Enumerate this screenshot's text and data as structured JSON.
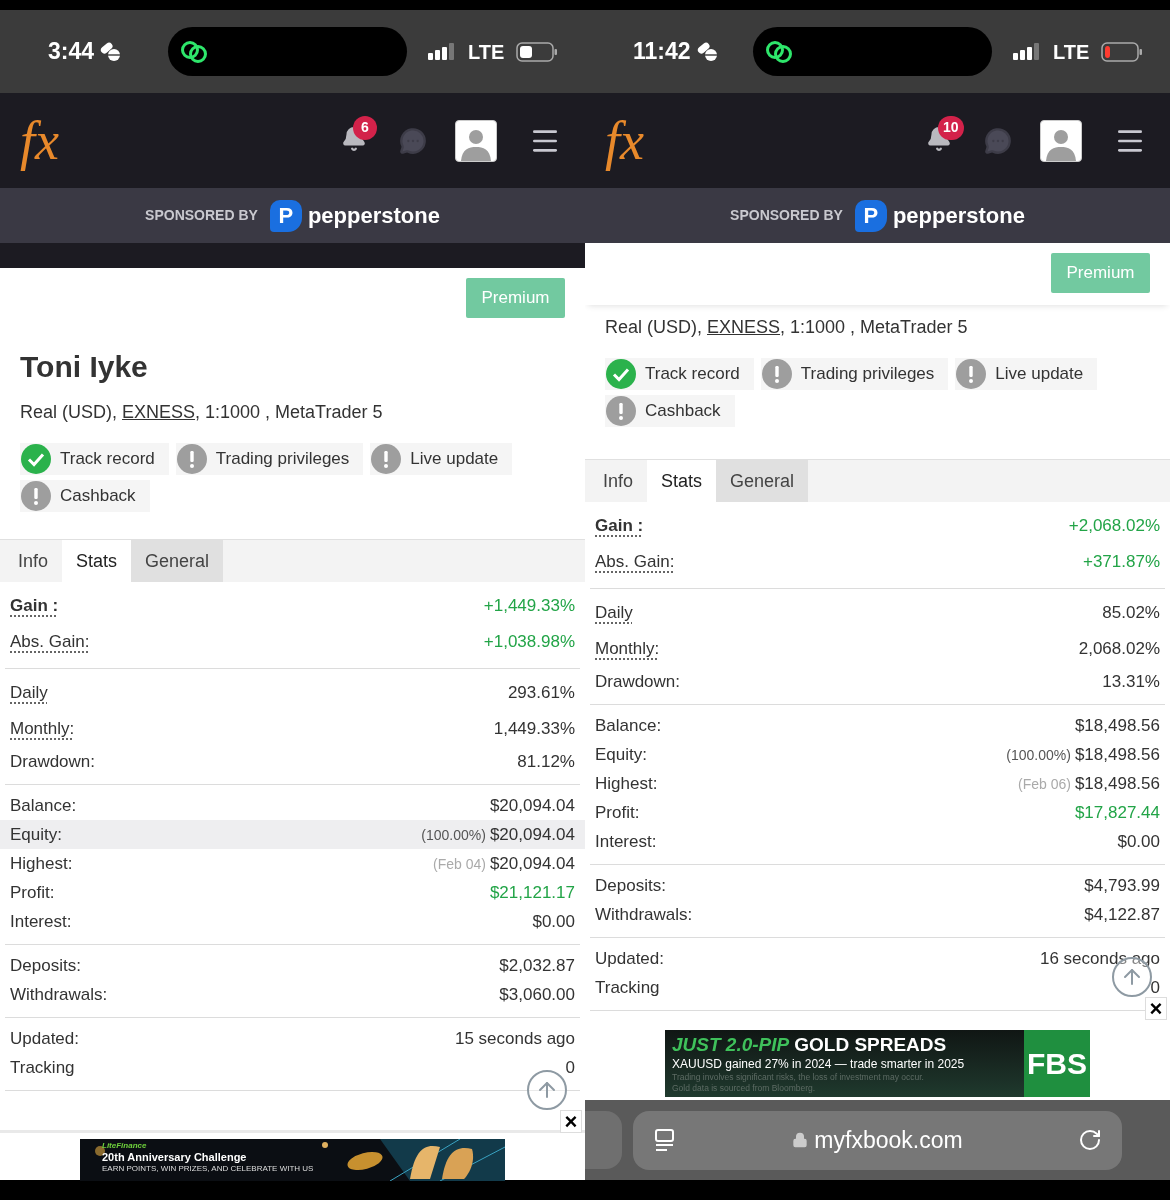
{
  "screens": [
    {
      "status_bar": {
        "time": "3:44",
        "network": "LTE",
        "battery_low": false
      },
      "header": {
        "logo": "fx",
        "notification_count": "6"
      },
      "sponsor": {
        "label": "SPONSORED BY",
        "logo_mark": "P",
        "brand": "pepperstone"
      },
      "premium_button": "Premium",
      "trader_name": "Toni Iyke",
      "account": {
        "before": "Real (USD), ",
        "broker": "EXNESS",
        "after": ", 1:1000 , MetaTrader 5"
      },
      "badges": [
        {
          "label": "Track record",
          "verified": true
        },
        {
          "label": "Trading privileges",
          "verified": false
        },
        {
          "label": "Live update",
          "verified": false
        },
        {
          "label": "Cashback",
          "verified": false
        }
      ],
      "tabs": [
        {
          "label": "Info",
          "selected": false,
          "highlighted": false
        },
        {
          "label": "Stats",
          "selected": true,
          "highlighted": false
        },
        {
          "label": "General",
          "selected": false,
          "highlighted": true
        }
      ],
      "stat_groups": [
        [
          {
            "kind": "headline",
            "label": "Gain :",
            "value": "+1,449.33%",
            "positive": true,
            "highlighted": false
          },
          {
            "kind": "metric",
            "label": "Abs. Gain:",
            "value": "+1,038.98%",
            "positive": true,
            "highlighted": false
          }
        ],
        [
          {
            "kind": "metric",
            "label": "Daily",
            "value": "293.61%",
            "positive": false,
            "highlighted": false
          },
          {
            "kind": "metric",
            "label": "Monthly:",
            "value": "1,449.33%",
            "positive": false,
            "highlighted": false
          },
          {
            "kind": "plain",
            "label": "Drawdown:",
            "value": "81.12%",
            "positive": false,
            "highlighted": false
          }
        ],
        [
          {
            "kind": "plain",
            "label": "Balance:",
            "value": "$20,094.04",
            "positive": false,
            "highlighted": false
          },
          {
            "kind": "plain",
            "label": "Equity:",
            "note": {
              "text": "(100.00%)",
              "muted": false
            },
            "value": "$20,094.04",
            "positive": false,
            "highlighted": true
          },
          {
            "kind": "plain",
            "label": "Highest:",
            "note": {
              "text": "(Feb 04)",
              "muted": true
            },
            "value": "$20,094.04",
            "positive": false,
            "highlighted": false
          },
          {
            "kind": "plain",
            "label": "Profit:",
            "value": "$21,121.17",
            "positive": true,
            "highlighted": false
          },
          {
            "kind": "plain",
            "label": "Interest:",
            "value": "$0.00",
            "positive": false,
            "highlighted": false
          }
        ],
        [
          {
            "kind": "plain",
            "label": "Deposits:",
            "value": "$2,032.87",
            "positive": false,
            "highlighted": false
          },
          {
            "kind": "plain",
            "label": "Withdrawals:",
            "value": "$3,060.00",
            "positive": false,
            "highlighted": false
          }
        ],
        [
          {
            "kind": "plain",
            "label": "Updated:",
            "value": "15 seconds ago",
            "positive": false,
            "highlighted": false
          },
          {
            "kind": "plain",
            "label": "Tracking",
            "value": "0",
            "positive": false,
            "highlighted": false
          }
        ]
      ],
      "close_button": "×",
      "ad": {
        "kind": "litefinance",
        "brand": "LiteFinance",
        "title": "20th Anniversary Challenge",
        "subtitle": "EARN POINTS, WIN PRIZES, AND CELEBRATE WITH US"
      }
    },
    {
      "status_bar": {
        "time": "11:42",
        "network": "LTE",
        "battery_low": true
      },
      "header": {
        "logo": "fx",
        "notification_count": "10"
      },
      "sponsor": {
        "label": "SPONSORED BY",
        "logo_mark": "P",
        "brand": "pepperstone"
      },
      "premium_button": "Premium",
      "account": {
        "before": "Real (USD), ",
        "broker": "EXNESS",
        "after": ", 1:1000 , MetaTrader 5"
      },
      "badges": [
        {
          "label": "Track record",
          "verified": true
        },
        {
          "label": "Trading privileges",
          "verified": false
        },
        {
          "label": "Live update",
          "verified": false
        },
        {
          "label": "Cashback",
          "verified": false
        }
      ],
      "tabs": [
        {
          "label": "Info",
          "selected": false,
          "highlighted": false
        },
        {
          "label": "Stats",
          "selected": true,
          "highlighted": false
        },
        {
          "label": "General",
          "selected": false,
          "highlighted": true
        }
      ],
      "stat_groups": [
        [
          {
            "kind": "headline",
            "label": "Gain :",
            "value": "+2,068.02%",
            "positive": true,
            "highlighted": false
          },
          {
            "kind": "metric",
            "label": "Abs. Gain:",
            "value": "+371.87%",
            "positive": true,
            "highlighted": false
          }
        ],
        [
          {
            "kind": "metric",
            "label": "Daily",
            "value": "85.02%",
            "positive": false,
            "highlighted": false
          },
          {
            "kind": "metric",
            "label": "Monthly:",
            "value": "2,068.02%",
            "positive": false,
            "highlighted": false
          },
          {
            "kind": "plain",
            "label": "Drawdown:",
            "value": "13.31%",
            "positive": false,
            "highlighted": false
          }
        ],
        [
          {
            "kind": "plain",
            "label": "Balance:",
            "value": "$18,498.56",
            "positive": false,
            "highlighted": false
          },
          {
            "kind": "plain",
            "label": "Equity:",
            "note": {
              "text": "(100.00%)",
              "muted": false
            },
            "value": "$18,498.56",
            "positive": false,
            "highlighted": false
          },
          {
            "kind": "plain",
            "label": "Highest:",
            "note": {
              "text": "(Feb 06)",
              "muted": true
            },
            "value": "$18,498.56",
            "positive": false,
            "highlighted": false
          },
          {
            "kind": "plain",
            "label": "Profit:",
            "value": "$17,827.44",
            "positive": true,
            "highlighted": false
          },
          {
            "kind": "plain",
            "label": "Interest:",
            "value": "$0.00",
            "positive": false,
            "highlighted": false
          }
        ],
        [
          {
            "kind": "plain",
            "label": "Deposits:",
            "value": "$4,793.99",
            "positive": false,
            "highlighted": false
          },
          {
            "kind": "plain",
            "label": "Withdrawals:",
            "value": "$4,122.87",
            "positive": false,
            "highlighted": false
          }
        ],
        [
          {
            "kind": "plain",
            "label": "Updated:",
            "value": "16 seconds ago",
            "positive": false,
            "highlighted": false
          },
          {
            "kind": "plain",
            "label": "Tracking",
            "value": "0",
            "positive": false,
            "highlighted": false
          }
        ]
      ],
      "close_button": "×",
      "ad": {
        "kind": "fbs",
        "headline_accent": "JUST 2.0-PIP",
        "headline": "GOLD SPREADS",
        "line": "XAUUSD gained 27% in 2024 — trade smarter in 2025",
        "disclaimer": [
          "Trading involves significant risks, the loss of investment may occur.",
          "Gold data is sourced from Bloomberg."
        ],
        "logo": "FBS"
      },
      "browser_bar": {
        "url": "myfxbook.com"
      }
    }
  ]
}
